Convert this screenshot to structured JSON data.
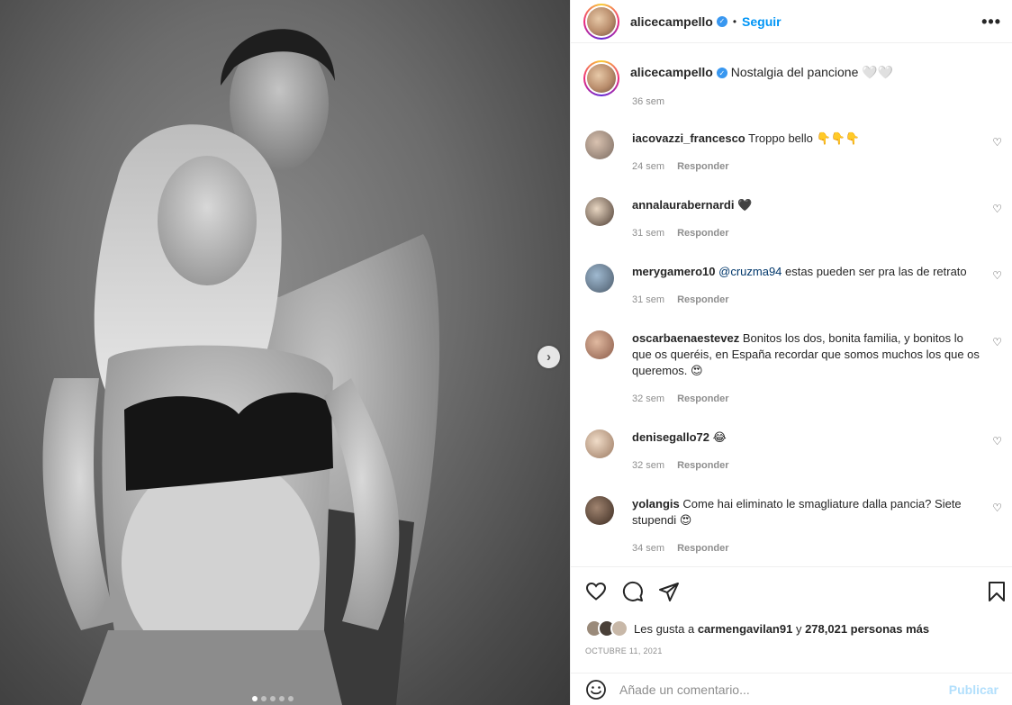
{
  "post": {
    "username": "alicecampello",
    "separator": "•",
    "follow_label": "Seguir",
    "more_label": "•••",
    "next_label": "›"
  },
  "caption": {
    "username": "alicecampello",
    "text": "Nostalgia del pancione 🤍🤍",
    "time": "36 sem"
  },
  "comments": [
    {
      "user": "iacovazzi_francesco",
      "text": "Troppo bello 👇👇👇",
      "time": "24 sem",
      "reply": "Responder"
    },
    {
      "user": "annalaurabernardi",
      "text": "🖤",
      "time": "31 sem",
      "reply": "Responder"
    },
    {
      "user": "merygamero10",
      "mention": "@cruzma94",
      "text": " estas pueden ser pra las de retrato",
      "time": "31 sem",
      "reply": "Responder"
    },
    {
      "user": "oscarbaenaestevez",
      "text": "Bonitos los dos, bonita familia, y bonitos lo que os queréis, en España recordar que somos muchos los que os queremos. 😍",
      "time": "32 sem",
      "reply": "Responder"
    },
    {
      "user": "denisegallo72",
      "text": "😂",
      "time": "32 sem",
      "reply": "Responder"
    },
    {
      "user": "yolangis",
      "text": "Come hai eliminato le smagliature dalla pancia? Siete stupendi 😍",
      "time": "34 sem",
      "reply": "Responder"
    }
  ],
  "likes": {
    "prefix": "Les gusta a ",
    "user": "carmengavilan91",
    "middle": " y ",
    "count": "278,021 personas más"
  },
  "date": "OCTUBRE 11, 2021",
  "add_comment": {
    "placeholder": "Añade un comentario...",
    "publish_label": "Publicar"
  },
  "colors": {
    "link_blue": "#0095f6",
    "verified_blue": "#3897f0",
    "muted": "#8e8e8e",
    "publish_disabled": "#b2dffc"
  },
  "icons": {
    "heart": "heart-icon",
    "comment": "comment-icon",
    "share": "share-icon",
    "save": "bookmark-icon",
    "emoji": "emoji-icon",
    "more": "more-icon",
    "next": "chevron-right-icon"
  }
}
